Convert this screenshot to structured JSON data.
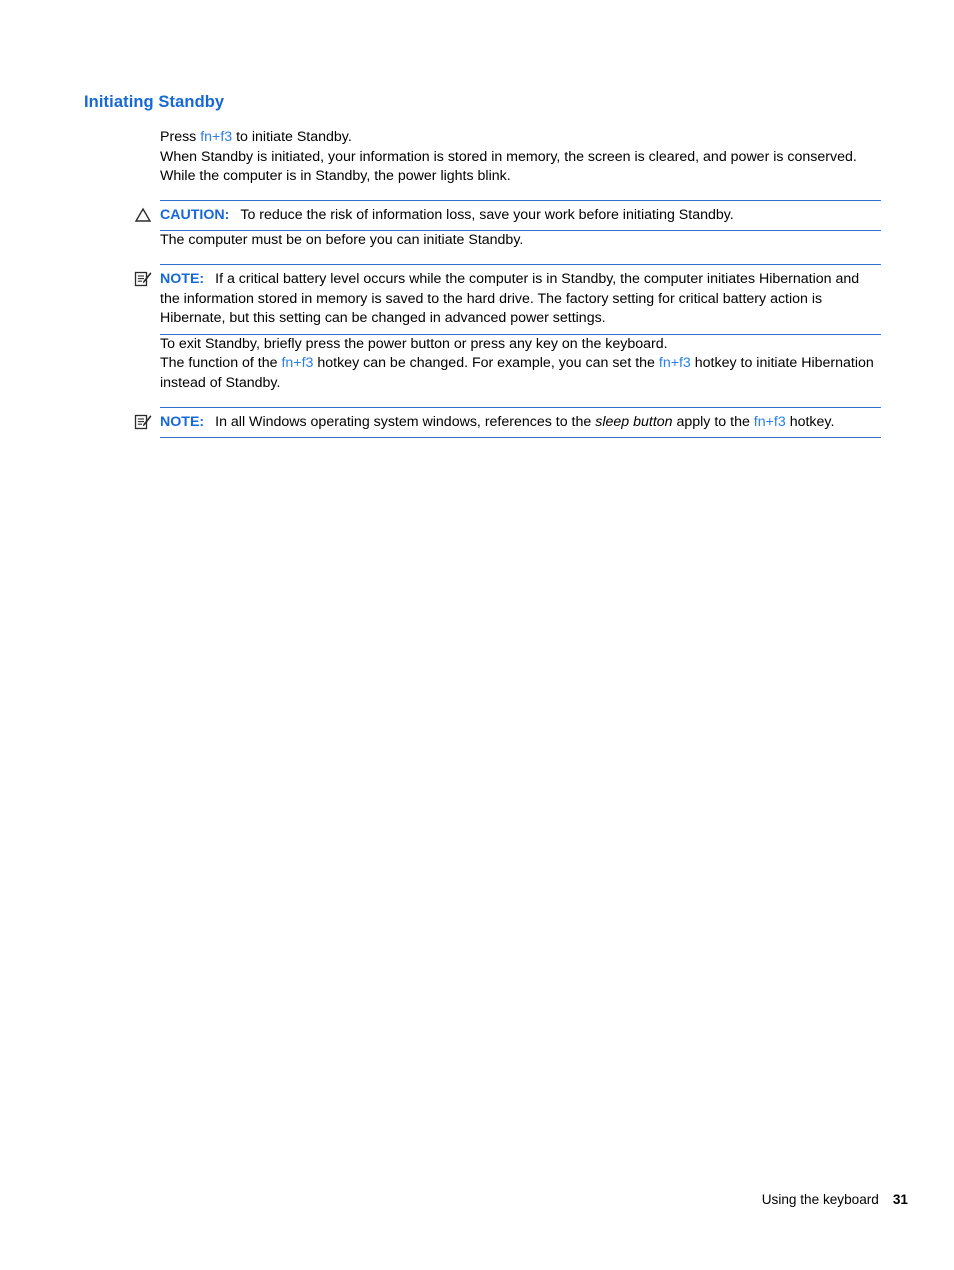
{
  "document": {
    "heading": "Initiating Standby",
    "paragraphs": {
      "press_prefix": "Press ",
      "hotkey_1": "fn+f3",
      "press_suffix": " to initiate Standby.",
      "standby_description": "When Standby is initiated, your information is stored in memory, the screen is cleared, and power is conserved. While the computer is in Standby, the power lights blink.",
      "must_be_on": "The computer must be on before you can initiate Standby.",
      "exit_standby": "To exit Standby, briefly press the power button or press any key on the keyboard.",
      "function_prefix": "The function of the ",
      "hotkey_2": "fn+f3",
      "function_middle": " hotkey can be changed. For example, you can set the ",
      "hotkey_3": "fn+f3",
      "function_suffix": " hotkey to initiate Hibernation instead of Standby."
    },
    "caution": {
      "label": "CAUTION:",
      "icon": "warning-triangle-icon",
      "text": "To reduce the risk of information loss, save your work before initiating Standby."
    },
    "note_1": {
      "label": "NOTE:",
      "icon": "note-pencil-icon",
      "text": "If a critical battery level occurs while the computer is in Standby, the computer initiates Hibernation and the information stored in memory is saved to the hard drive. The factory setting for critical battery action is Hibernate, but this setting can be changed in advanced power settings."
    },
    "note_2": {
      "label": "NOTE:",
      "icon": "note-pencil-icon",
      "text_prefix": "In all Windows operating system windows, references to the ",
      "italic_term": "sleep button",
      "text_middle": " apply to the ",
      "hotkey": "fn+f3",
      "text_suffix": " hotkey."
    },
    "footer": {
      "section": "Using the keyboard",
      "page_number": "31"
    },
    "colors": {
      "heading_blue": "#1668d8",
      "label_blue": "#1668d8",
      "hotkey_blue": "#2a7fe8",
      "rule_blue": "#2f6fd0",
      "body_black": "#000000",
      "page_background": "#ffffff"
    }
  }
}
